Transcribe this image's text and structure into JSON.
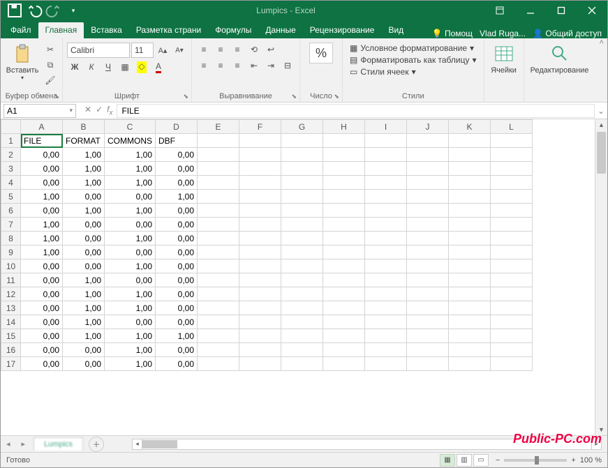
{
  "title": "Lumpics - Excel",
  "tabs": {
    "file": "Файл",
    "home": "Главная",
    "insert": "Вставка",
    "layout": "Разметка страни",
    "formulas": "Формулы",
    "data": "Данные",
    "review": "Рецензирование",
    "view": "Вид",
    "tellme": "Помощ",
    "user": "Vlad Ruga...",
    "share": "Общий доступ"
  },
  "ribbon": {
    "clipboard": {
      "label": "Буфер обмена",
      "paste": "Вставить"
    },
    "font": {
      "label": "Шрифт",
      "name": "Calibri",
      "size": "11"
    },
    "alignment": {
      "label": "Выравнивание"
    },
    "number": {
      "label": "Число",
      "btn": "%"
    },
    "styles": {
      "label": "Стили",
      "conditional": "Условное форматирование",
      "table": "Форматировать как таблицу",
      "cell": "Стили ячеек"
    },
    "cells": {
      "label": "Ячейки"
    },
    "editing": {
      "label": "Редактирование"
    }
  },
  "namebox": "A1",
  "formula": "FILE",
  "columns": [
    "A",
    "B",
    "C",
    "D",
    "E",
    "F",
    "G",
    "H",
    "I",
    "J",
    "K",
    "L"
  ],
  "headers": [
    "FILE",
    "FORMAT",
    "COMMONS",
    "DBF"
  ],
  "rows": [
    [
      "0,00",
      "1,00",
      "1,00",
      "0,00"
    ],
    [
      "0,00",
      "1,00",
      "1,00",
      "0,00"
    ],
    [
      "0,00",
      "1,00",
      "1,00",
      "0,00"
    ],
    [
      "1,00",
      "0,00",
      "0,00",
      "1,00"
    ],
    [
      "0,00",
      "1,00",
      "1,00",
      "0,00"
    ],
    [
      "1,00",
      "0,00",
      "0,00",
      "0,00"
    ],
    [
      "1,00",
      "0,00",
      "1,00",
      "0,00"
    ],
    [
      "1,00",
      "0,00",
      "0,00",
      "0,00"
    ],
    [
      "0,00",
      "0,00",
      "1,00",
      "0,00"
    ],
    [
      "0,00",
      "1,00",
      "0,00",
      "0,00"
    ],
    [
      "0,00",
      "1,00",
      "1,00",
      "0,00"
    ],
    [
      "0,00",
      "1,00",
      "1,00",
      "0,00"
    ],
    [
      "0,00",
      "1,00",
      "0,00",
      "0,00"
    ],
    [
      "0,00",
      "1,00",
      "1,00",
      "1,00"
    ],
    [
      "0,00",
      "0,00",
      "1,00",
      "0,00"
    ],
    [
      "0,00",
      "0,00",
      "1,00",
      "0,00"
    ]
  ],
  "status": {
    "ready": "Готово",
    "zoom": "100 %"
  },
  "sheet_tab": "Lumpics",
  "watermark": "Public-PC.com"
}
